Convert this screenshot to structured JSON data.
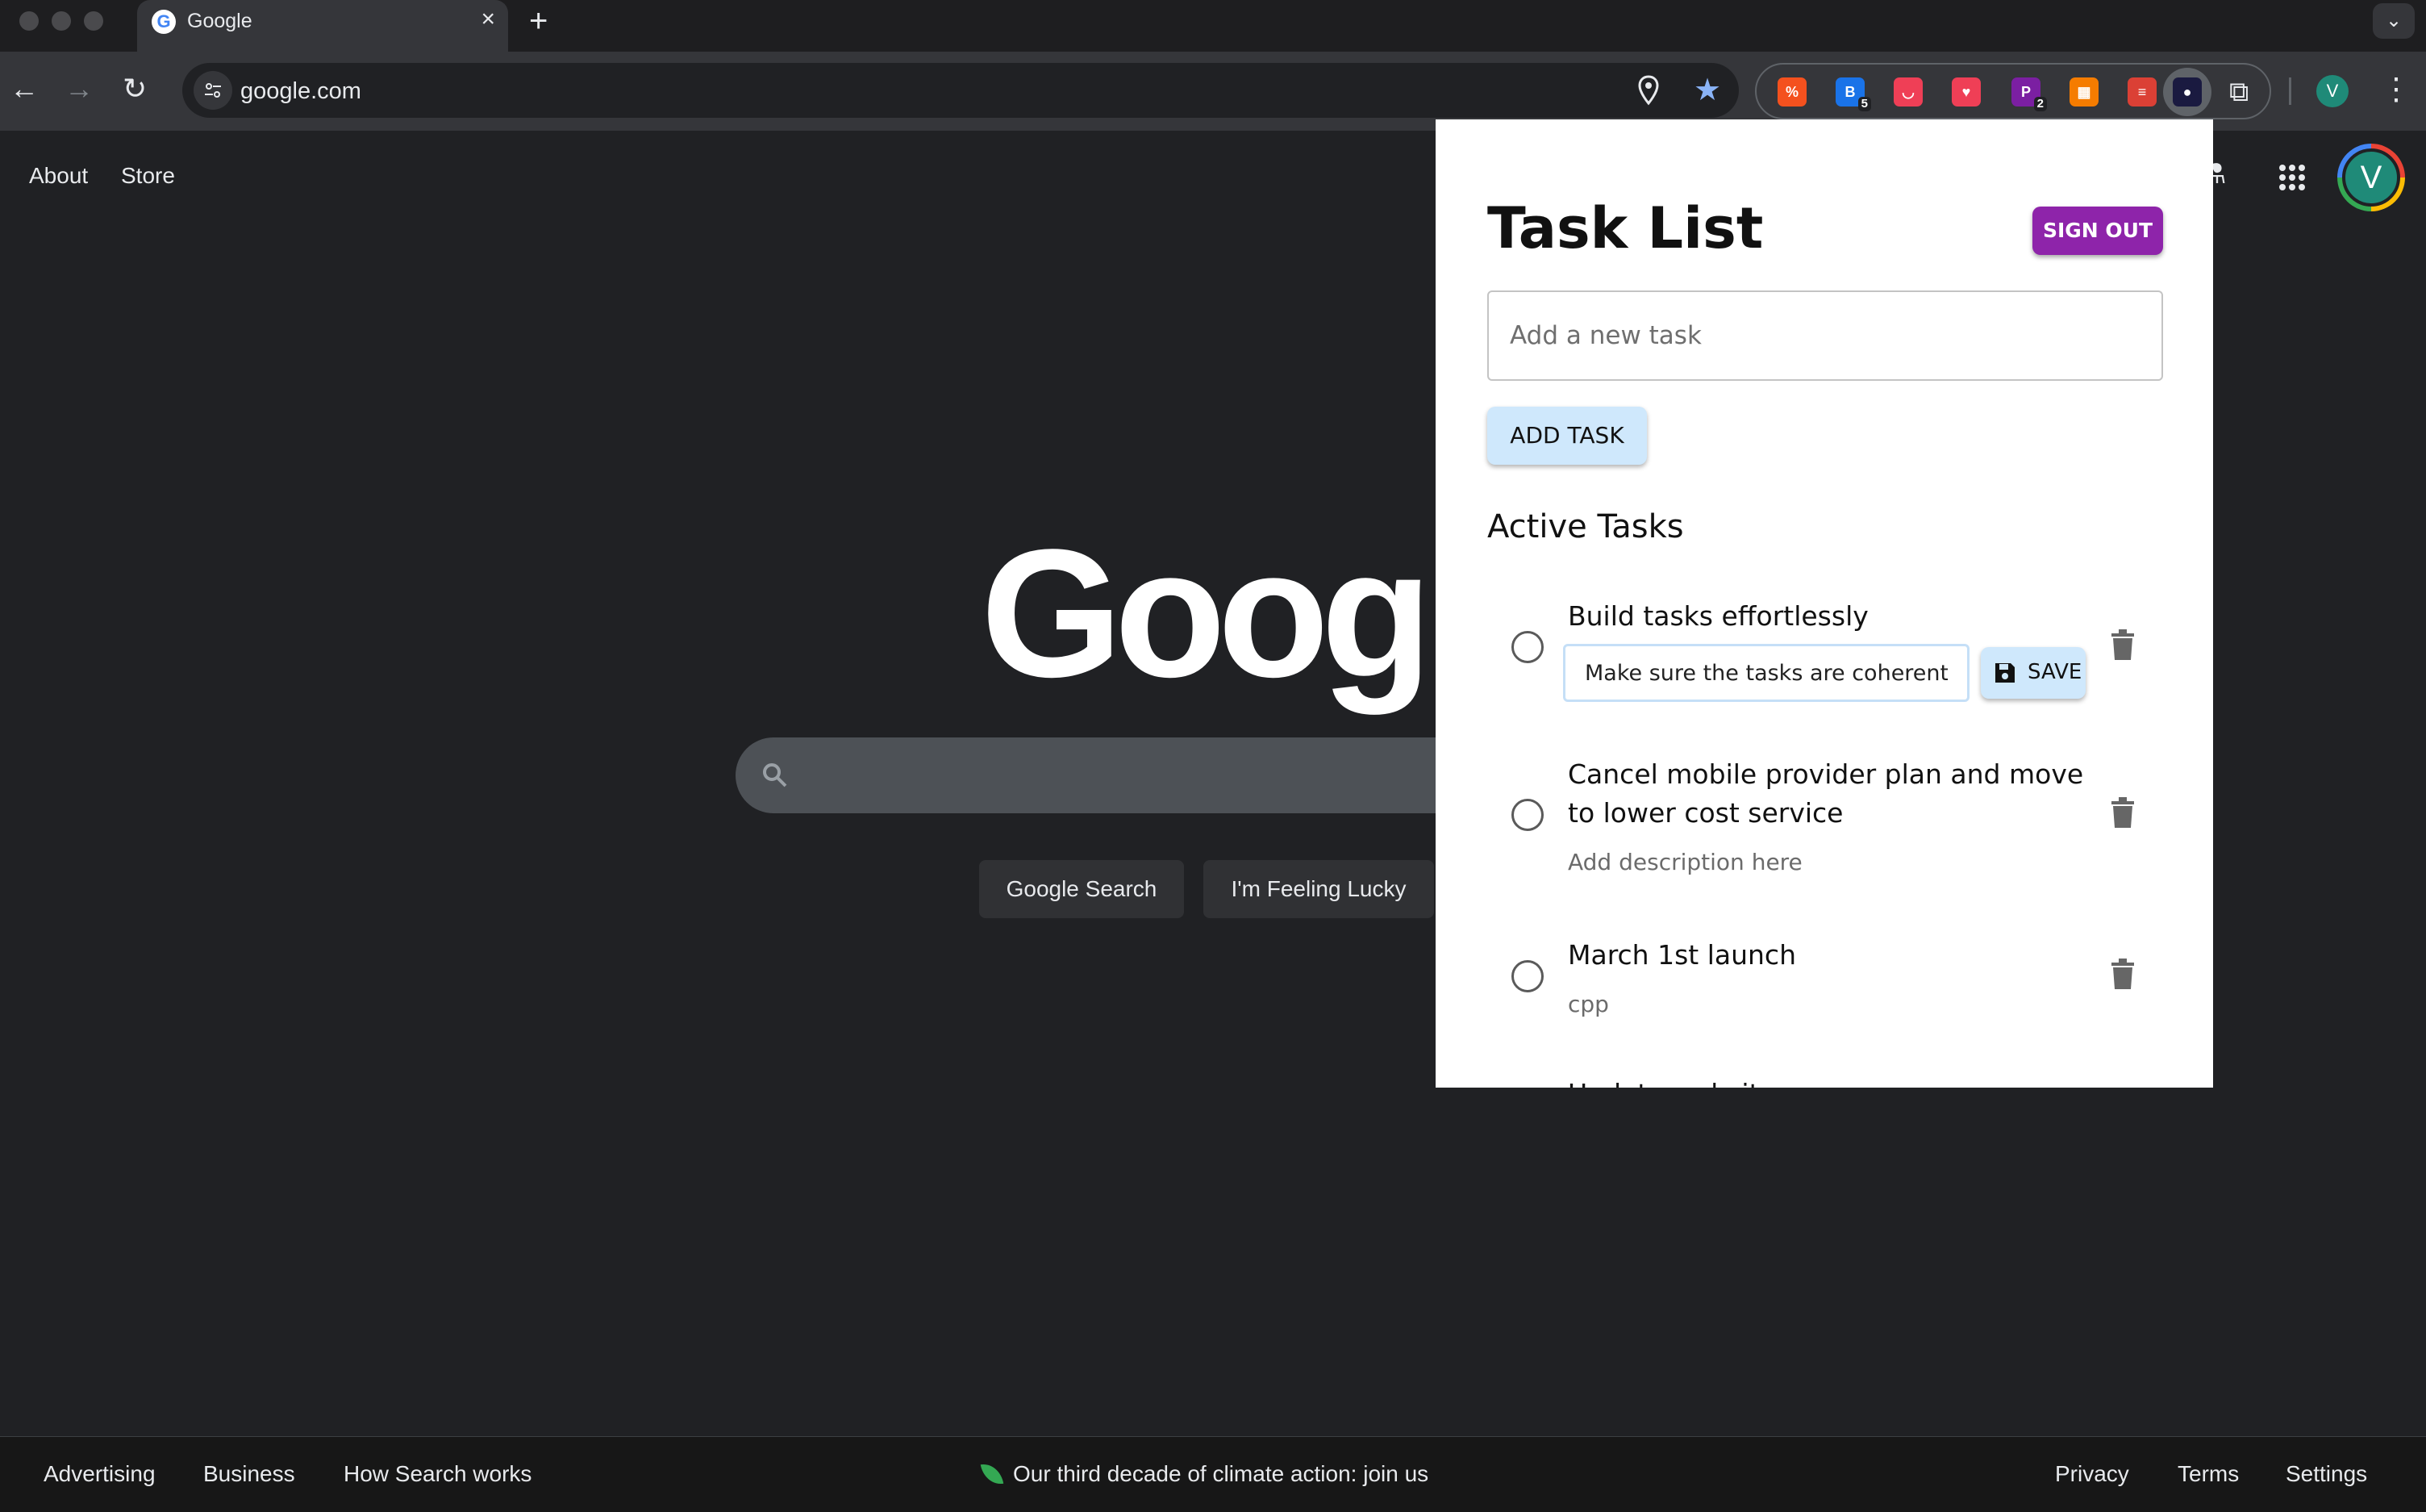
{
  "browser": {
    "tab_title": "Google",
    "tab_close_glyph": "×",
    "new_tab_glyph": "+",
    "tab_search_glyph": "⌄",
    "back_glyph": "←",
    "forward_glyph": "→",
    "reload_glyph": "↻",
    "url": "google.com",
    "star_glyph": "★",
    "profile_initial": "V",
    "menu_glyph": "⋮",
    "extensions_glyph": "⧉",
    "extensions": [
      {
        "name": "ext-tag-icon",
        "label": "%",
        "color": "#f4511e"
      },
      {
        "name": "ext-shield-icon",
        "label": "B",
        "color": "#1a73e8",
        "badge": "5"
      },
      {
        "name": "ext-pocket-icon",
        "label": "◡",
        "color": "#ef3f56"
      },
      {
        "name": "ext-heart-icon",
        "label": "♥",
        "color": "#ef3f56"
      },
      {
        "name": "ext-p-icon",
        "label": "P",
        "color": "#7b1fa2",
        "badge": "2"
      },
      {
        "name": "ext-layout-icon",
        "label": "▦",
        "color": "#f57c00"
      },
      {
        "name": "ext-todoist-icon",
        "label": "≡",
        "color": "#db4035"
      },
      {
        "name": "ext-tasks-icon",
        "label": "●",
        "color": "#1a1a40"
      }
    ]
  },
  "google": {
    "about": "About",
    "store": "Store",
    "logo": "Google",
    "search_button": "Google Search",
    "lucky_button": "I'm Feeling Lucky",
    "labs_glyph": "⚗",
    "avatar_initial": "V",
    "footer": {
      "advertising": "Advertising",
      "business": "Business",
      "how_search_works": "How Search works",
      "climate": "Our third decade of climate action: join us",
      "privacy": "Privacy",
      "terms": "Terms",
      "settings": "Settings"
    }
  },
  "popup": {
    "title": "Task List",
    "sign_out": "SIGN OUT",
    "new_task_placeholder": "Add a new task",
    "add_task": "ADD TASK",
    "active_tasks_heading": "Active Tasks",
    "tasks": [
      {
        "title": "Build tasks effortlessly",
        "editing_value": "Make sure the tasks are coherent",
        "save_label": "SAVE"
      },
      {
        "title": "Cancel mobile provider plan and move to lower cost service",
        "description": "Add description here"
      },
      {
        "title": "March 1st launch",
        "description": "cpp"
      }
    ],
    "partially_visible_task": "Update website"
  }
}
